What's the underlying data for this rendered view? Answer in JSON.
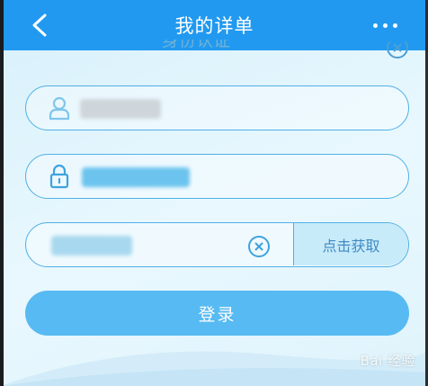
{
  "header": {
    "title": "我的详单"
  },
  "dialog": {
    "title_partial": "身份认证"
  },
  "form": {
    "username_value": "",
    "password_value": "",
    "code_value": "",
    "get_code_label": "点击获取",
    "login_label": "登录"
  },
  "watermark": {
    "text": "Bai 经验"
  },
  "colors": {
    "topbar": "#2199f0",
    "field_border": "#4fb0e6",
    "login_button": "#57baf2",
    "code_button_bg": "#c8ebfa",
    "code_button_text": "#3f8ac2"
  }
}
